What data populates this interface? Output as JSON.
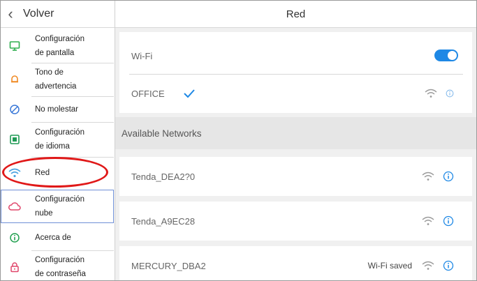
{
  "sidebar": {
    "back_label": "Volver",
    "items": [
      {
        "line1": "Configuración",
        "line2": "de pantalla",
        "icon": "monitor-icon",
        "color": "#2eae4f"
      },
      {
        "line1": "Tono de",
        "line2": "advertencia",
        "icon": "bell-icon",
        "color": "#f08a24"
      },
      {
        "line1": "No molestar",
        "line2": "",
        "icon": "do-not-disturb-icon",
        "color": "#3a78d8"
      },
      {
        "line1": "Configuración",
        "line2": "de idioma",
        "icon": "language-icon",
        "color": "#1f9a55"
      },
      {
        "line1": "Red",
        "line2": "",
        "icon": "wifi-icon",
        "color": "#4aa3e0"
      },
      {
        "line1": "Configuración",
        "line2": "nube",
        "icon": "cloud-icon",
        "color": "#e0456a"
      },
      {
        "line1": "Acerca de",
        "line2": "",
        "icon": "info-icon",
        "color": "#21a04f"
      },
      {
        "line1": "Configuración",
        "line2": "de contraseña",
        "icon": "lock-icon",
        "color": "#e0456a"
      }
    ]
  },
  "header": {
    "title": "Red"
  },
  "wifi": {
    "label": "Wi-Fi",
    "enabled": true,
    "accent": "#1e88e5"
  },
  "connected": {
    "ssid": "OFFICE"
  },
  "section_title": "Available Networks",
  "networks": [
    {
      "ssid": "Tenda_DEA2?0",
      "status": ""
    },
    {
      "ssid": "Tenda_A9EC28",
      "status": ""
    },
    {
      "ssid": "MERCURY_DBA2",
      "status": "Wi-Fi saved"
    }
  ]
}
